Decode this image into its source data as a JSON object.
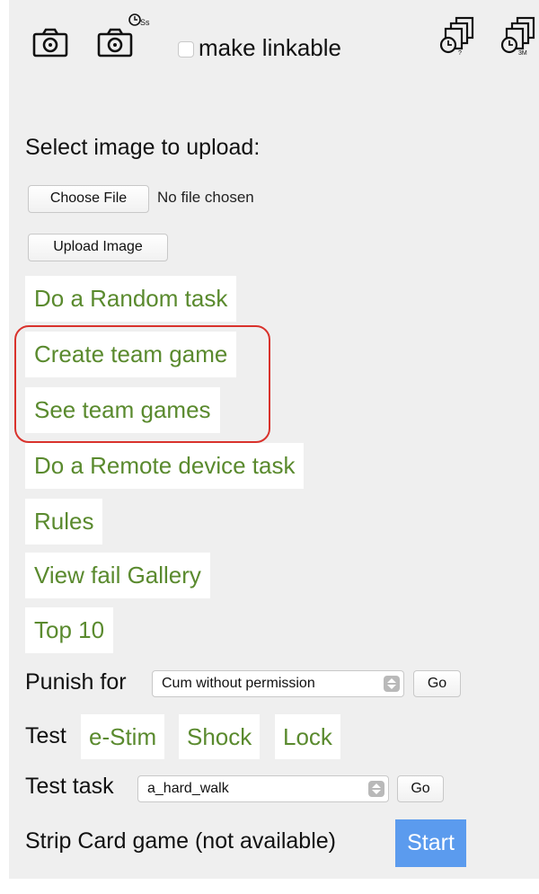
{
  "toolbar": {
    "camera_icon": "camera-icon",
    "camera_timer_icon": "camera-timer-icon",
    "linkable_label": "make linkable",
    "pages_timer_icon": "stacked-pages-timer-icon",
    "pages_timer_3m_icon": "stacked-pages-timer-3m-icon"
  },
  "upload": {
    "label": "Select image to upload:",
    "choose_file_label": "Choose File",
    "file_status": "No file chosen",
    "upload_button_label": "Upload Image"
  },
  "menu": {
    "items": [
      {
        "label": "Do a Random task"
      },
      {
        "label": "Create team game"
      },
      {
        "label": "See team games"
      },
      {
        "label": "Do a Remote device task"
      },
      {
        "label": "Rules"
      },
      {
        "label": "View fail Gallery"
      },
      {
        "label": "Top 10"
      }
    ]
  },
  "punish": {
    "label": "Punish for",
    "selected": "Cum without permission",
    "go_label": "Go"
  },
  "test": {
    "label": "Test",
    "options": [
      {
        "label": "e-Stim"
      },
      {
        "label": "Shock"
      },
      {
        "label": "Lock"
      }
    ]
  },
  "test_task": {
    "label": "Test task",
    "selected": "a_hard_walk",
    "go_label": "Go"
  },
  "strip_card": {
    "label": "Strip Card game (not available)",
    "start_label": "Start"
  },
  "colors": {
    "panel_bg": "#efefef",
    "link_green": "#5a8a2e",
    "highlight_red": "#d9322c",
    "start_blue": "#5b9bee"
  }
}
